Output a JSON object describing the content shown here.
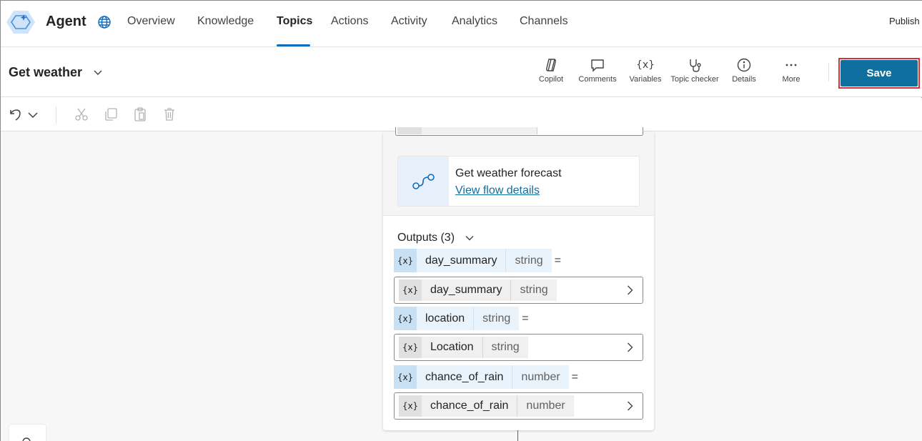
{
  "nav": {
    "agent_name": "Agent",
    "tabs": [
      "Overview",
      "Knowledge",
      "Topics",
      "Actions",
      "Activity",
      "Analytics",
      "Channels"
    ],
    "active_tab": "Topics",
    "publish_label": "Publish"
  },
  "titlebar": {
    "topic_title": "Get weather",
    "tools": {
      "copilot": "Copilot",
      "comments": "Comments",
      "variables": "Variables",
      "variables_glyph": "{x}",
      "topic_checker": "Topic checker",
      "details": "Details",
      "more": "More"
    },
    "save_label": "Save"
  },
  "flow": {
    "name": "Get weather forecast",
    "link": "View flow details"
  },
  "outputs": {
    "header": "Outputs (3)",
    "var_glyph": "{x}",
    "equals": "=",
    "items": [
      {
        "var_name": "day_summary",
        "var_type": "string",
        "field_name": "day_summary",
        "field_type": "string"
      },
      {
        "var_name": "location",
        "var_type": "string",
        "field_name": "Location",
        "field_type": "string"
      },
      {
        "var_name": "chance_of_rain",
        "var_type": "number",
        "field_name": "chance_of_rain",
        "field_type": "number"
      }
    ]
  },
  "colors": {
    "accent": "#0f6cbd",
    "save": "#0f6f9e",
    "highlight_outline": "#d13438"
  }
}
